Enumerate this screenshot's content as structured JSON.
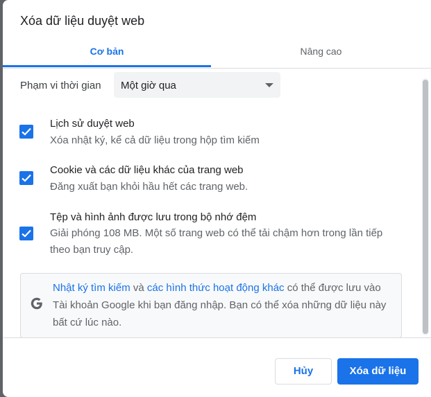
{
  "dialog": {
    "title": "Xóa dữ liệu duyệt web"
  },
  "tabs": [
    {
      "label": "Cơ bản"
    },
    {
      "label": "Nâng cao"
    }
  ],
  "time_range": {
    "label": "Phạm vi thời gian",
    "value": "Một giờ qua"
  },
  "options": [
    {
      "title": "Lịch sử duyệt web",
      "desc": "Xóa nhật ký, kể cả dữ liệu trong hộp tìm kiếm",
      "checked": true
    },
    {
      "title": "Cookie và các dữ liệu khác của trang web",
      "desc": "Đăng xuất bạn khỏi hầu hết các trang web.",
      "checked": true
    },
    {
      "title": "Tệp và hình ảnh được lưu trong bộ nhớ đệm",
      "desc": "Giải phóng 108 MB. Một số trang web có thể tải chậm hơn trong lần tiếp theo bạn truy cập.",
      "checked": true
    }
  ],
  "info": {
    "link1": "Nhật ký tìm kiếm",
    "and": "và",
    "link2": "các hình thức hoạt động khác",
    "rest": "có thể được lưu vào Tài khoản Google khi bạn đăng nhập. Bạn có thể xóa những dữ liệu này bất cứ lúc nào."
  },
  "buttons": {
    "cancel": "Hủy",
    "clear": "Xóa dữ liệu"
  },
  "colors": {
    "accent": "#1a73e8",
    "text": "#202124",
    "secondary": "#5f6368"
  },
  "icons": {
    "checkbox": "check-icon",
    "dropdown": "chevron-down-icon",
    "info": "google-g-icon"
  }
}
